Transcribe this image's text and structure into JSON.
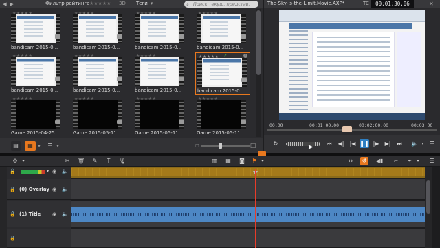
{
  "library": {
    "filter_label": "Фильтр рейтинга",
    "filter_stars": "★★★★★",
    "mode_3d": "3D",
    "tags_label": "Теги",
    "search_placeholder": "Поиск текущ. представ.",
    "selected_badge_check": "✓",
    "info_badge": "i",
    "items": [
      {
        "name": "bandicam 2015-0...",
        "stars": "★★★★★",
        "kind": "screen"
      },
      {
        "name": "bandicam 2015-0...",
        "stars": "★★★★★",
        "kind": "screen"
      },
      {
        "name": "bandicam 2015-0...",
        "stars": "★★★★★",
        "kind": "screen"
      },
      {
        "name": "bandicam 2015-0...",
        "stars": "★★★★★",
        "kind": "screen"
      },
      {
        "name": "bandicam 2015-0...",
        "stars": "★★★★★",
        "kind": "screen"
      },
      {
        "name": "bandicam 2015-0...",
        "stars": "★★★★★",
        "kind": "screen"
      },
      {
        "name": "bandicam 2015-0...",
        "stars": "★★★★★",
        "kind": "screen"
      },
      {
        "name": "bandicam 2015-0...",
        "stars": "★★★★★",
        "kind": "screen",
        "selected": true
      },
      {
        "name": "Game 2015-04-25...",
        "stars": "★★★★★",
        "kind": "dark"
      },
      {
        "name": "Game 2015-05-11...",
        "stars": "★★★★★",
        "kind": "dark"
      },
      {
        "name": "Game 2015-05-11...",
        "stars": "★★★★★",
        "kind": "dark"
      },
      {
        "name": "Game 2015-05-11...",
        "stars": "★★★★★",
        "kind": "dark"
      }
    ]
  },
  "player": {
    "title": "The-Sky-is-the-Limit.Movie.AXP*",
    "tc_label": "TC",
    "timecode": "00:01:30.06",
    "scrub_ticks": [
      "00.00",
      "00:01:00.00",
      "00:02:00.00",
      "00:03:00"
    ],
    "playhead_fraction": 0.47
  },
  "timeline": {
    "tracks": [
      {
        "name": "(0) Overlay"
      },
      {
        "name": "(1) Title"
      }
    ],
    "playhead_fraction": 0.52
  },
  "colors": {
    "accent": "#e8781e",
    "play_active": "#2e7fc2",
    "playhead": "#e83c2a",
    "audio_clip": "#4d87c4"
  }
}
